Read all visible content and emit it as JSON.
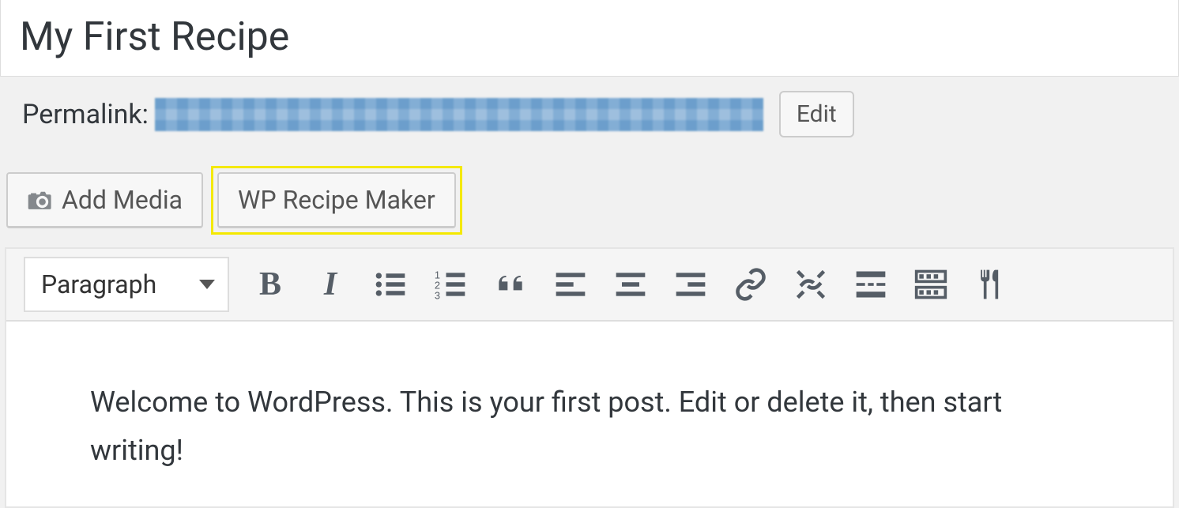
{
  "title": "My First Recipe",
  "permalink": {
    "label": "Permalink:",
    "edit": "Edit"
  },
  "mediaButtons": {
    "addMedia": "Add Media",
    "recipeMaker": "WP Recipe Maker"
  },
  "toolbar": {
    "formatSelect": "Paragraph"
  },
  "content": "Welcome to WordPress. This is your first post. Edit or delete it, then start writing!"
}
